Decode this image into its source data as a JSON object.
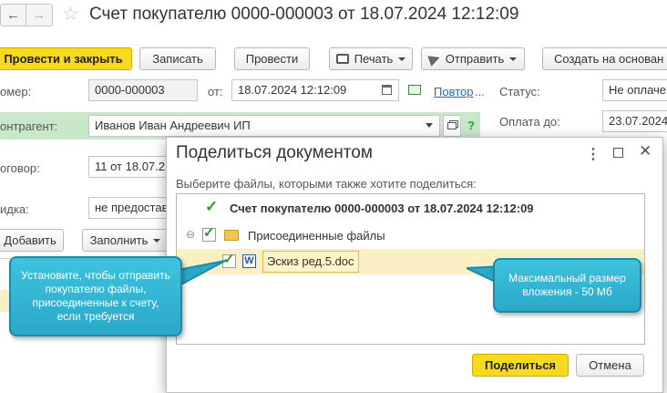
{
  "window": {
    "nav_back": "←",
    "nav_forward": "→",
    "title": "Счет покупателю 0000-000003 от 18.07.2024 12:12:09"
  },
  "toolbar": {
    "post_and_close": "Провести и закрыть",
    "save": "Записать",
    "post": "Провести",
    "print": "Печать",
    "send": "Отправить",
    "create_based": "Создать на основан"
  },
  "form": {
    "number_label": "омер:",
    "number_value": "0000-000003",
    "date_label": "от:",
    "date_value": "18.07.2024 12:12:09",
    "repeat_link": "Повтор",
    "status_label": "Статус:",
    "status_value": "Не оплачен",
    "counterparty_label": "онтрагент:",
    "counterparty_value": "Иванов Иван Андреевич ИП",
    "pay_until_label": "Оплата до:",
    "pay_until_value": "23.07.2024",
    "contract_label": "оговор:",
    "contract_value": "11 от 18.07.2",
    "discount_label": "идка:",
    "discount_value": "не предоставл",
    "add_button": "Добавить",
    "fill_button": "Заполнить",
    "help": "?"
  },
  "dialog": {
    "title": "Поделиться документом",
    "prompt": "Выберите файлы, которыми также хотите поделиться:",
    "tree": {
      "root_label": "Счет покупателю 0000-000003 от 18.07.2024 12:12:09",
      "folder_label": "Присоединенные файлы",
      "file_label": "Эскиз ред.5.doc",
      "file_icon_letter": "W",
      "collapse_symbol": "⊖"
    },
    "share_button": "Поделиться",
    "cancel_button": "Отмена"
  },
  "callouts": {
    "left": "Установите, чтобы отправить покупателю файлы, присоединенные к счету, если требуется",
    "right": "Максимальный размер вложения - 50 Мб"
  },
  "colors": {
    "accent_yellow": "#f7d91f",
    "callout_blue": "#2fb4d2",
    "check_green": "#2f9a34",
    "highlight_row": "#fbf0c4",
    "link_blue": "#2a66b8"
  }
}
